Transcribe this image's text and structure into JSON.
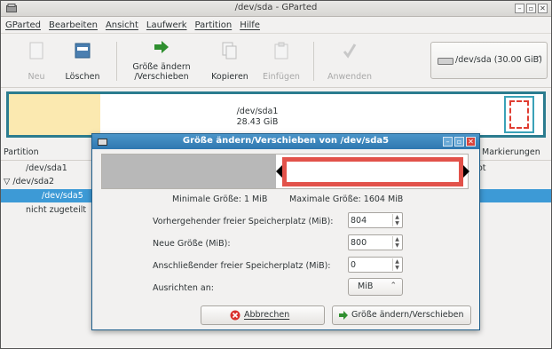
{
  "window": {
    "title": "/dev/sda - GParted"
  },
  "window_buttons": [
    "–",
    "▫",
    "✕"
  ],
  "menu": [
    "GParted",
    "Bearbeiten",
    "Ansicht",
    "Laufwerk",
    "Partition",
    "Hilfe"
  ],
  "toolbar": {
    "new": "Neu",
    "delete": "Löschen",
    "resize_line1": "Größe ändern",
    "resize_line2": "/Verschieben",
    "copy": "Kopieren",
    "paste": "Einfügen",
    "apply": "Anwenden"
  },
  "device": {
    "label": "/dev/sda  (30.00 GiB)",
    "arrow": "⌃"
  },
  "diskmap": {
    "name": "/dev/sda1",
    "size": "28.43 GiB"
  },
  "list": {
    "headers": {
      "partition": "Partition",
      "flags": "Markierungen"
    },
    "rows": [
      {
        "name": "/dev/sda1",
        "flags": "ot"
      },
      {
        "name": "▽ /dev/sda2",
        "flags": ""
      },
      {
        "name": "/dev/sda5",
        "flags": ""
      },
      {
        "name": "nicht zugeteilt",
        "flags": ""
      }
    ]
  },
  "dialog": {
    "title": "Größe ändern/Verschieben von /dev/sda5",
    "min_label": "Minimale Größe: 1 MiB",
    "max_label": "Maximale Größe: 1604 MiB",
    "fields": {
      "free_before_label": "Vorhergehender freier Speicherplatz (MiB):",
      "free_before_value": "804",
      "new_size_label": "Neue Größe (MiB):",
      "new_size_value": "800",
      "free_after_label": "Anschließender freier Speicherplatz (MiB):",
      "free_after_value": "0",
      "align_label": "Ausrichten an:",
      "align_value": "MiB"
    },
    "cancel_label": "Abbrechen",
    "ok_label": "Größe ändern/Verschieben"
  },
  "colors": {
    "selection": "#3d9ad6",
    "dialog_title": "#2f78b0",
    "partition_ext4": "#fbe9b0",
    "extended_border": "#3aa2b8",
    "resize_box": "#e2524a"
  }
}
